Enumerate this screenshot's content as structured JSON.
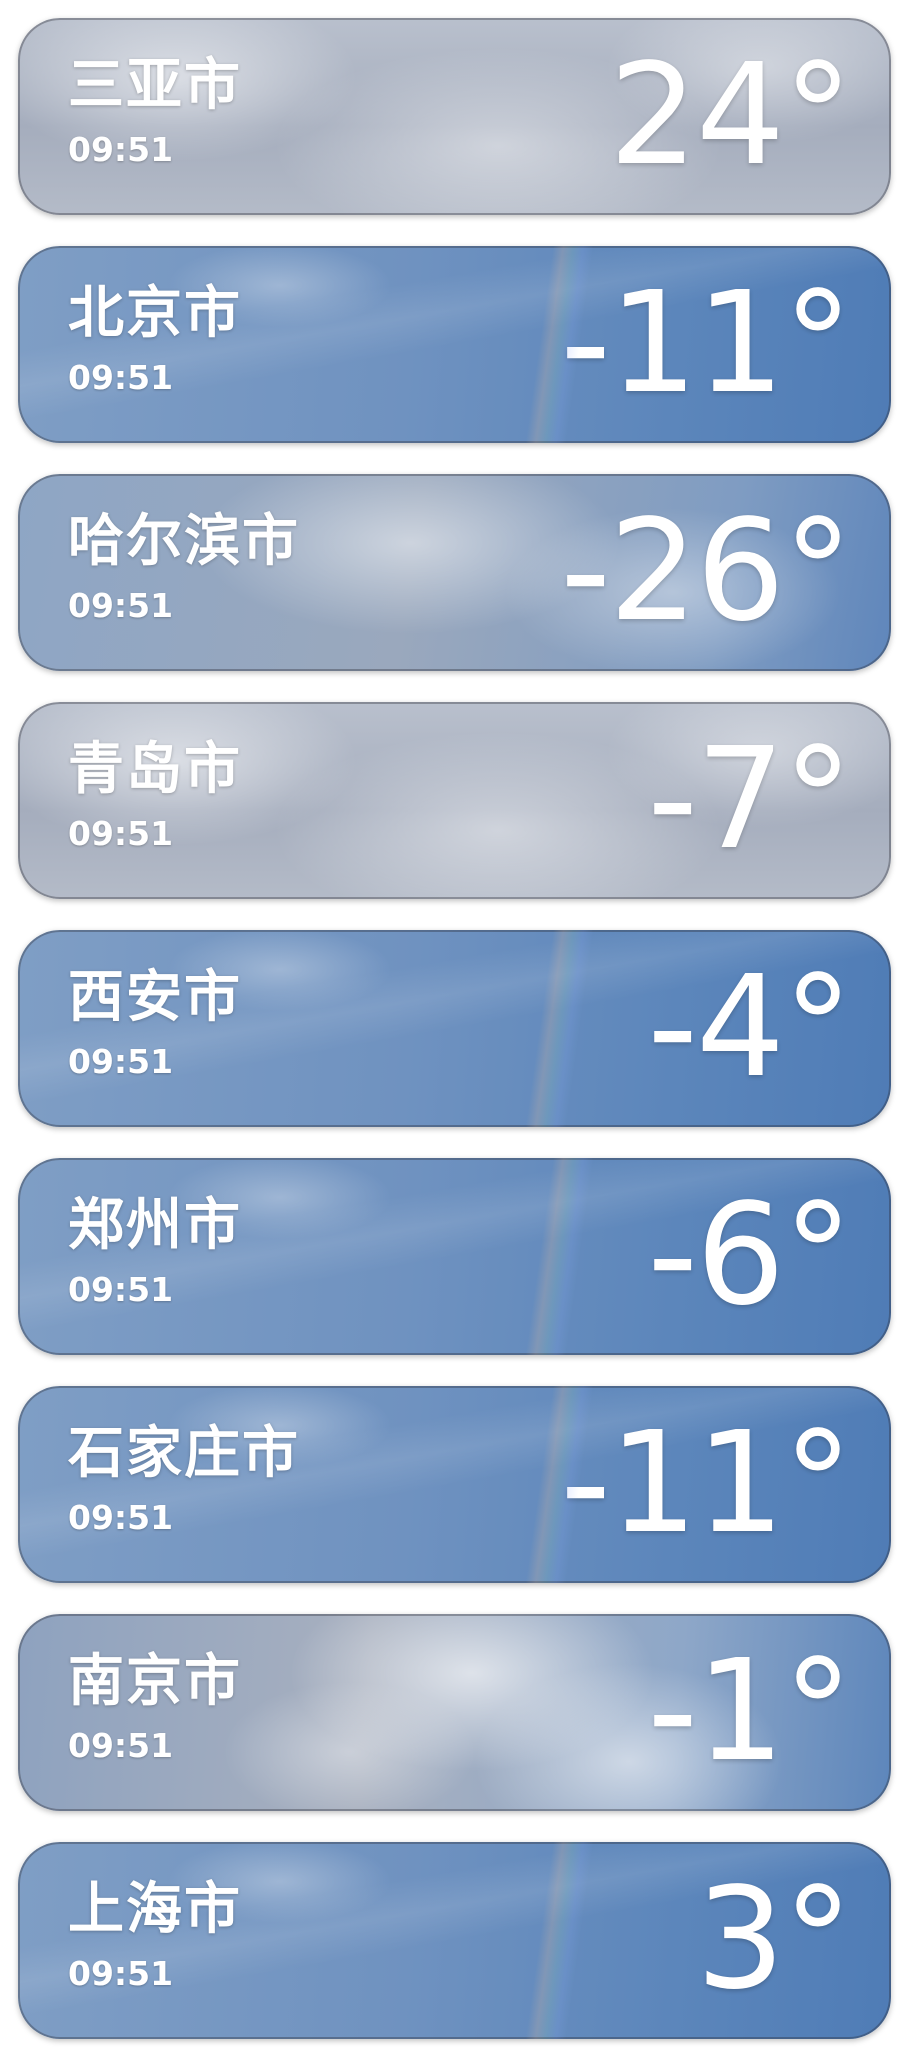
{
  "colors": {
    "text": "#ffffff",
    "cloudy_bg": "#b9c0cd",
    "clear_bg": "#6f92c0"
  },
  "cities": [
    {
      "name": "三亚市",
      "time": "09:51",
      "temp": "24°",
      "sky": "cloudy"
    },
    {
      "name": "北京市",
      "time": "09:51",
      "temp": "-11°",
      "sky": "clear"
    },
    {
      "name": "哈尔滨市",
      "time": "09:51",
      "temp": "-26°",
      "sky": "mixed"
    },
    {
      "name": "青岛市",
      "time": "09:51",
      "temp": "-7°",
      "sky": "cloudy"
    },
    {
      "name": "西安市",
      "time": "09:51",
      "temp": "-4°",
      "sky": "clear"
    },
    {
      "name": "郑州市",
      "time": "09:51",
      "temp": "-6°",
      "sky": "clear"
    },
    {
      "name": "石家庄市",
      "time": "09:51",
      "temp": "-11°",
      "sky": "clear"
    },
    {
      "name": "南京市",
      "time": "09:51",
      "temp": "-1°",
      "sky": "mixed-clouds"
    },
    {
      "name": "上海市",
      "time": "09:51",
      "temp": "3°",
      "sky": "clear"
    }
  ]
}
